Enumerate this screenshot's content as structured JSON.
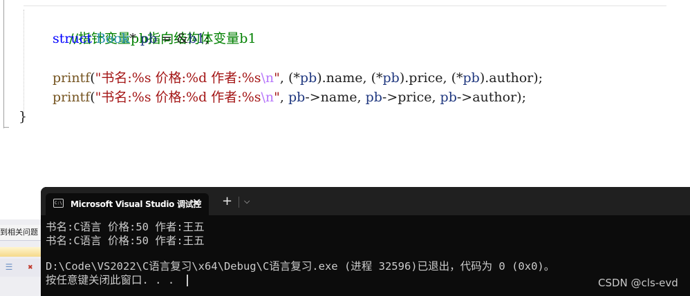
{
  "editor": {
    "comment": "//指针变量pb指向结构体变量b1",
    "decl": {
      "kw": "struct",
      "type": "Book",
      "star": "* ",
      "var": "pb",
      "rest": " = &",
      "target": "b1",
      "end": ";"
    },
    "printf1": {
      "fn": "printf",
      "open": "(",
      "str": "\"书名:%s 价格:%d 作者:%s",
      "esc": "\\n",
      "strend": "\"",
      "args_a": ", (*",
      "pb1": "pb",
      "args_b": ").name, (*",
      "pb2": "pb",
      "args_c": ").price, (*",
      "pb3": "pb",
      "args_d": ").author);"
    },
    "printf2": {
      "fn": "printf",
      "open": "(",
      "str": "\"书名:%s 价格:%d 作者:%s",
      "esc": "\\n",
      "strend": "\"",
      "args_a": ", ",
      "pb1": "pb",
      "args_b": "->name, ",
      "pb2": "pb",
      "args_c": "->price, ",
      "pb3": "pb",
      "args_d": "->author);"
    },
    "closing_brace": "}"
  },
  "left_panel": {
    "tab_text": "到相关问题"
  },
  "terminal": {
    "tab_icon": "console-icon",
    "tab_icon_text": "C:\\",
    "tab_title": "Microsoft Visual Studio 调试控",
    "close_glyph": "✕",
    "new_tab_glyph": "+",
    "dropdown_glyph": "⌵",
    "lines": [
      "书名:C语言 价格:50 作者:王五",
      "书名:C语言 价格:50 作者:王五",
      "",
      "D:\\Code\\VS2022\\C语言复习\\x64\\Debug\\C语言复习.exe (进程 32596)已退出，代码为 0 (0x0)。",
      "按任意键关闭此窗口. . ."
    ]
  },
  "watermark": "CSDN @cls-evd"
}
